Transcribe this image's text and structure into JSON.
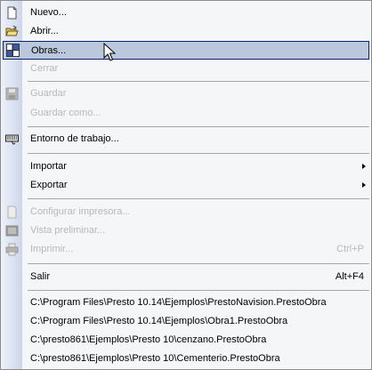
{
  "menu": {
    "nuevo": {
      "label": "Nuevo...",
      "icon": "new-document-icon"
    },
    "abrir": {
      "label": "Abrir...",
      "icon": "open-folder-icon"
    },
    "obras": {
      "label": "Obras...",
      "icon": "works-icon"
    },
    "cerrar": {
      "label": "Cerrar"
    },
    "guardar": {
      "label": "Guardar",
      "icon": "save-icon"
    },
    "guardar_como": {
      "label": "Guardar como..."
    },
    "entorno": {
      "label": "Entorno de trabajo...",
      "icon": "keyboard-icon"
    },
    "importar": {
      "label": "Importar"
    },
    "exportar": {
      "label": "Exportar"
    },
    "configurar": {
      "label": "Configurar impresora...",
      "icon": "page-setup-icon"
    },
    "vista": {
      "label": "Vista preliminar...",
      "icon": "print-preview-icon"
    },
    "imprimir": {
      "label": "Imprimir...",
      "shortcut": "Ctrl+P",
      "icon": "printer-icon"
    },
    "salir": {
      "label": "Salir",
      "shortcut": "Alt+F4"
    },
    "recent": [
      "C:\\Program Files\\Presto 10.14\\Ejemplos\\PrestoNavision.PrestoObra",
      "C:\\Program Files\\Presto 10.14\\Ejemplos\\Obra1.PrestoObra",
      "C:\\presto861\\Ejemplos\\Presto 10\\cenzano.PrestoObra",
      "C:\\presto861\\Ejemplos\\Presto 10\\Cementerio.PrestoObra"
    ]
  },
  "colors": {
    "highlight": "#bac7dd",
    "highlight_border": "#0a246a",
    "disabled_text": "#b8b8b8"
  }
}
